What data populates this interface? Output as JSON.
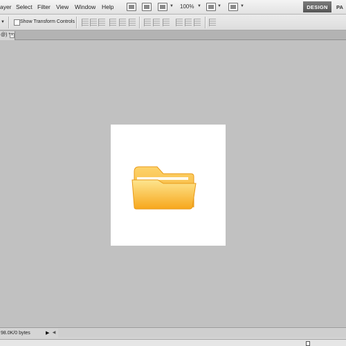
{
  "menu": {
    "items": [
      "ayer",
      "Select",
      "Filter",
      "View",
      "Window",
      "Help"
    ],
    "zoom": "100%",
    "workspace_button": "DESIGN",
    "workspace_next": "PA"
  },
  "options": {
    "show_transform_label": "Show Transform Controls",
    "show_transform_checked": false
  },
  "document_tab": {
    "label": "@) *",
    "close": "×"
  },
  "canvas": {
    "folder_icon": "folder-icon",
    "folder_colors": {
      "top": "#fdd36b",
      "bottom": "#f7a71c",
      "edge": "#e89a1a"
    }
  },
  "status": {
    "doc_info": "98.0K/0 bytes",
    "arrow": "▶",
    "scroll_left": "◀"
  }
}
